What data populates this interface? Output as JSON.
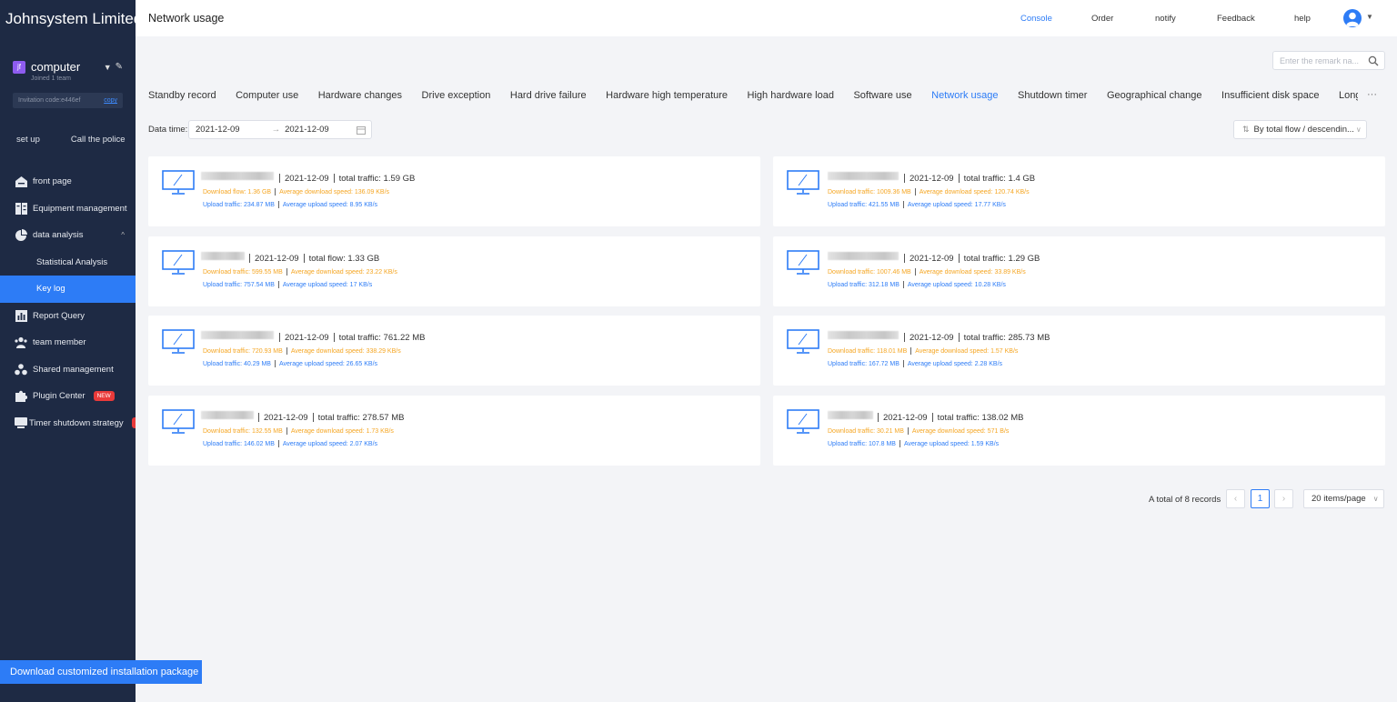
{
  "app": {
    "brand": "Johnsystem Limited",
    "page_title": "Network usage"
  },
  "topnav": {
    "console": "Console",
    "order": "Order",
    "notify": "notify",
    "feedback": "Feedback",
    "help": "help"
  },
  "team": {
    "badge": "jf",
    "name": "computer",
    "sub": "Joined 1 team",
    "invite_label": "Invitation code:e446ef",
    "invite_copy": "copy"
  },
  "tools": {
    "setup": "set up",
    "call": "Call the police"
  },
  "nav": {
    "front_page": "front page",
    "equipment": "Equipment management",
    "data_analysis": "data analysis",
    "statistical": "Statistical Analysis",
    "key_log": "Key log",
    "report_query": "Report Query",
    "team_member": "team member",
    "shared": "Shared management",
    "plugin": "Plugin Center",
    "plugin_badge": "NEW",
    "timer": "Timer shutdown strategy"
  },
  "download_button": "Download customized installation package",
  "search": {
    "placeholder": "Enter the remark na..."
  },
  "tabs": [
    "Standby record",
    "Computer use",
    "Hardware changes",
    "Drive exception",
    "Hard drive failure",
    "Hardware high temperature",
    "High hardware load",
    "Software use",
    "Network usage",
    "Shutdown timer",
    "Geographical change",
    "Insufficient disk space",
    "Long-term of"
  ],
  "tabs_more": "···",
  "filter": {
    "date_label": "Data time:",
    "start": "2021-12-09",
    "end": "2021-12-09",
    "sort": "By total flow / descendin..."
  },
  "cards": [
    {
      "date": "2021-12-09",
      "total": "total traffic: 1.59 GB",
      "download": "Download flow: 1.36 GB",
      "avg_down": "Average download speed: 136.09 KB/s",
      "upload": "Upload traffic: 234.87 MB",
      "avg_up": "Average upload speed: 8.95 KB/s"
    },
    {
      "date": "2021-12-09",
      "total": "total traffic: 1.4 GB",
      "download": "Download traffic: 1009.36 MB",
      "avg_down": "Average download speed: 120.74 KB/s",
      "upload": "Upload traffic: 421.55 MB",
      "avg_up": "Average upload speed: 17.77 KB/s"
    },
    {
      "date": "2021-12-09",
      "total": "total flow: 1.33 GB",
      "download": "Download traffic: 599.55 MB",
      "avg_down": "Average download speed: 23.22 KB/s",
      "upload": "Upload traffic: 757.54 MB",
      "avg_up": "Average upload speed: 17 KB/s"
    },
    {
      "date": "2021-12-09",
      "total": "total traffic: 1.29 GB",
      "download": "Download traffic: 1007.46 MB",
      "avg_down": "Average download speed: 33.89 KB/s",
      "upload": "Upload traffic: 312.18 MB",
      "avg_up": "Average upload speed: 10.28 KB/s"
    },
    {
      "date": "2021-12-09",
      "total": "total traffic: 761.22 MB",
      "download": "Download traffic: 720.93 MB",
      "avg_down": "Average download speed: 338.29 KB/s",
      "upload": "Upload traffic: 40.29 MB",
      "avg_up": "Average upload speed: 26.65 KB/s"
    },
    {
      "date": "2021-12-09",
      "total": "total traffic: 285.73 MB",
      "download": "Download traffic: 118.01 MB",
      "avg_down": "Average download speed: 1.57 KB/s",
      "upload": "Upload traffic: 167.72 MB",
      "avg_up": "Average upload speed: 2.28 KB/s"
    },
    {
      "date": "2021-12-09",
      "total": "total traffic: 278.57 MB",
      "download": "Download traffic: 132.55 MB",
      "avg_down": "Average download speed: 1.73 KB/s",
      "upload": "Upload traffic: 146.02 MB",
      "avg_up": "Average upload speed: 2.07 KB/s"
    },
    {
      "date": "2021-12-09",
      "total": "total traffic: 138.02 MB",
      "download": "Download traffic: 30.21 MB",
      "avg_down": "Average download speed: 571 B/s",
      "upload": "Upload traffic: 107.8 MB",
      "avg_up": "Average upload speed: 1.59 KB/s"
    }
  ],
  "pagination": {
    "total": "A total of 8 records",
    "current": "1",
    "page_size": "20 items/page",
    "prev": "‹",
    "next": "›"
  }
}
